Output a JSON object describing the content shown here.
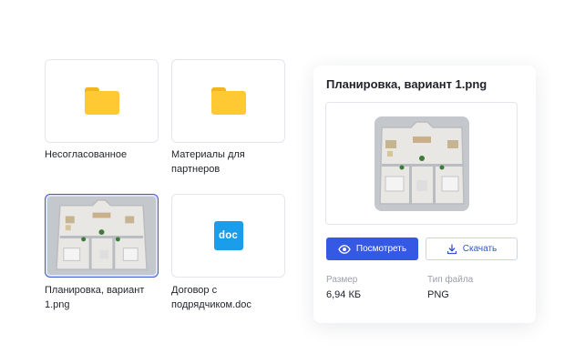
{
  "files": [
    {
      "label": "Несогласованное",
      "kind": "folder"
    },
    {
      "label": "Материалы для партнеров",
      "kind": "folder"
    },
    {
      "label": "Планировка, вариант 1.png",
      "kind": "image"
    },
    {
      "label": "Договор с подрядчиком.doc",
      "kind": "doc",
      "badge": "doc"
    }
  ],
  "panel": {
    "title": "Планировка, вариант 1.png",
    "view_button": "Посмотреть",
    "download_button": "Скачать",
    "size_label": "Размер",
    "size_value": "6,94 КБ",
    "type_label": "Тип файла",
    "type_value": "PNG"
  },
  "colors": {
    "accent": "#3659e3",
    "folder": "#ffc934",
    "doc_badge": "#1a9dea",
    "selected_border": "#3f5bd8"
  },
  "icons": [
    "folder-icon",
    "doc-file-icon",
    "eye-icon",
    "download-icon"
  ]
}
